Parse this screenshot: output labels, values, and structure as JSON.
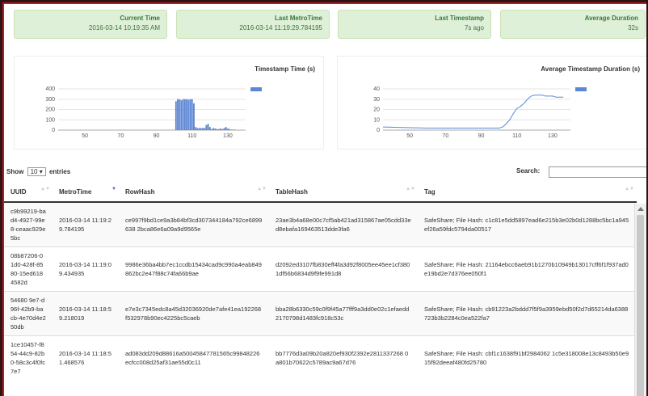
{
  "stats": [
    {
      "title": "Current Time",
      "value": "2016-03-14 10:19:35 AM"
    },
    {
      "title": "Last MetroTime",
      "value": "2016-03-14 11:19:29.784195"
    },
    {
      "title": "Last Timestamp",
      "value": "7s ago"
    },
    {
      "title": "Average Duration",
      "value": "32s"
    }
  ],
  "chart_data": [
    {
      "type": "bar",
      "title": "Timestamp Time (s)",
      "xlabel": "",
      "ylabel": "",
      "xlim": [
        35,
        140
      ],
      "ylim": [
        0,
        400
      ],
      "x_ticks": [
        50,
        70,
        90,
        110,
        130
      ],
      "y_ticks": [
        0,
        100,
        200,
        300,
        400
      ],
      "series": [
        {
          "color": "#5d86d4",
          "x": [
            101,
            102,
            103,
            104,
            105,
            106,
            107,
            108,
            109,
            110,
            111,
            112,
            113,
            114,
            115,
            116,
            117,
            118,
            119,
            120,
            121,
            122,
            123,
            124,
            125,
            126,
            127,
            128,
            129,
            130,
            131,
            132,
            133,
            134
          ],
          "values": [
            280,
            300,
            300,
            290,
            300,
            300,
            300,
            295,
            300,
            300,
            260,
            30,
            20,
            20,
            20,
            20,
            20,
            50,
            60,
            30,
            10,
            20,
            15,
            10,
            10,
            15,
            10,
            20,
            30,
            15,
            10,
            5,
            5,
            5
          ]
        }
      ],
      "legend": "top-right"
    },
    {
      "type": "line",
      "title": "Average Timestamp Duration (s)",
      "xlabel": "",
      "ylabel": "",
      "xlim": [
        35,
        140
      ],
      "ylim": [
        0,
        40
      ],
      "x_ticks": [
        50,
        70,
        90,
        110,
        130
      ],
      "y_ticks": [
        0,
        10,
        20,
        30,
        40
      ],
      "series": [
        {
          "color": "#5d86d4",
          "x": [
            35,
            60,
            80,
            100,
            102,
            104,
            106,
            108,
            110,
            112,
            114,
            116,
            118,
            120,
            122,
            124,
            126,
            128,
            130,
            132,
            134,
            136
          ],
          "values": [
            3,
            2,
            2,
            2,
            3,
            6,
            10,
            16,
            21,
            23,
            26,
            30,
            33,
            34,
            34,
            34,
            33,
            33,
            33,
            32,
            32,
            32
          ]
        }
      ],
      "legend": "top-right"
    }
  ],
  "table": {
    "show_label": "Show",
    "entries_label": "entries",
    "page_size": "10",
    "search_label": "Search:",
    "columns": [
      "UUID",
      "MetroTime",
      "RowHash",
      "TableHash",
      "Tag"
    ],
    "rows": [
      [
        "c9b99219-bad4-4927-99e8-ceaac929e5bc",
        "2016-03-14 11:19:29.784195",
        "ce997f9bd1ce9a3b84bf3cd307344184a792ce6899638 2bca86e6a09a9d9565e",
        "23ae3b4a68e00c7cf5ab421ad315867ae05cdd33ed8ebafa169463513dde3fa6",
        "SafeShare; File Hash: c1c81e5dd5897ead6e215b3e02b0d1288bc5bc1a945ef26a59fdc5794da00517"
      ],
      [
        "08b87206-01d0-428f-8580-15ed6184582d",
        "2016-03-14 11:19:09.434935",
        "9986e36ba4bb7ec1ccdb15434cad9c990a4eab849862bc2e47f88c74fa66b9ae",
        "d2092ed3107fb830eff4fa3d92f8005ee45ee1cf3801df56b6834d9f9fe991d8",
        "SafeShare; File Hash: 21164ebcc6aeb91b1270b10949b13017cff6f1f937ad0e19bd2e7d376ee050f1"
      ],
      [
        "54680 9e7-d96f-42b9-bacb-4e70d4e250db",
        "2016-03-14 11:18:59.218019",
        "e7e3c7345edc8a45d32036920de7afe41ea192268f532978b90ec4225bc5caeb",
        "bba28b6330c59c0f9f45a77fff9a3dd0e02c1efaedd2170798d1483fc918c53c",
        "SafeShare; File Hash: cb91223a2bddd7f5f9a3959ebd50f2d7d65214da6388723b3b2284c0ea522fa7"
      ],
      [
        "1ce10457-f854-44c9-82b0-58c3c4f0fc7e7",
        "2016-03-14 11:18:51.468576",
        "ad083dd209d88616a50045847781565c99848226ecfcc008d25af31ae55d0c11",
        "bb7776d3a09b20a820ef930f2392e2811337268 0a801b70622c5789ac9a67d76",
        "SafeShare; File Hash: cbf1c1638f91bf2984062 1c5e318008e13c8493b50e915f92deeaf480fd25780"
      ]
    ]
  }
}
